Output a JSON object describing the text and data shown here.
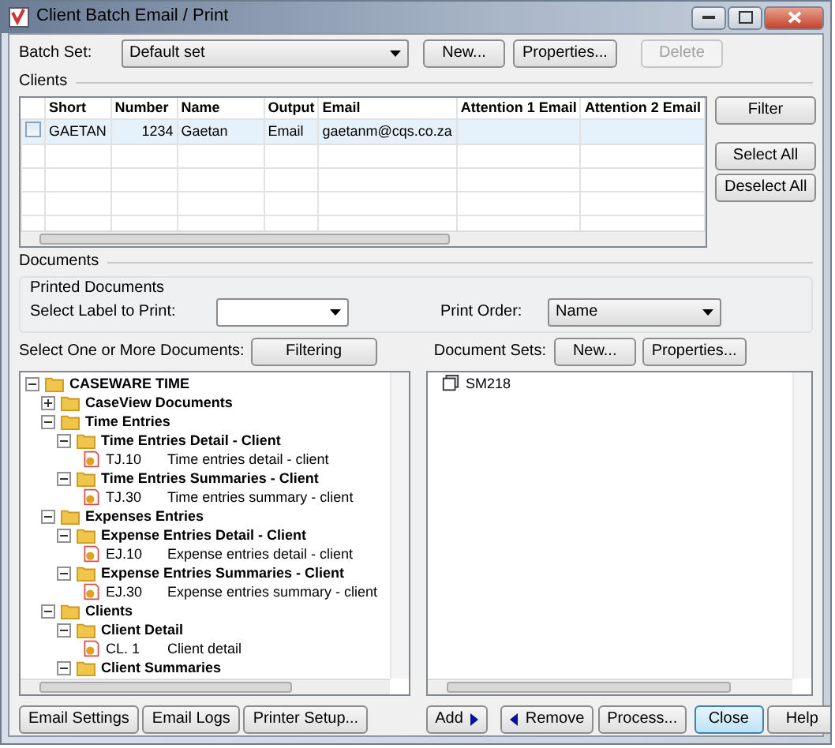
{
  "window": {
    "title": "Client Batch Email / Print"
  },
  "batch_set": {
    "label": "Batch Set:",
    "value": "Default set",
    "buttons": [
      {
        "label": "New...",
        "disabled": false
      },
      {
        "label": "Properties...",
        "disabled": false
      },
      {
        "label": "Delete",
        "disabled": true
      }
    ]
  },
  "clients": {
    "title": "Clients",
    "columns": [
      "Short",
      "Number",
      "Name",
      "Output",
      "Email",
      "Attention 1 Email",
      "Attention 2 Email"
    ],
    "rows": [
      {
        "checked": false,
        "selected": true,
        "cells": [
          "GAETAN",
          "1234",
          "Gaetan",
          "Email",
          "gaetanm@cqs.co.za",
          "",
          ""
        ]
      }
    ],
    "side_buttons": [
      "Filter",
      "Select All",
      "Deselect All"
    ]
  },
  "documents": {
    "title": "Documents",
    "printed_title": "Printed Documents",
    "label_to_print": {
      "label": "Select Label to Print:"
    },
    "print_order": {
      "label": "Print Order:",
      "value": "Name"
    },
    "select_label": "Select One or More Documents:",
    "filtering_button": "Filtering",
    "sets_label": "Document Sets:",
    "sets_buttons": [
      "New...",
      "Properties..."
    ],
    "tree": [
      {
        "kind": "folder",
        "label": "CASEWARE TIME",
        "expanded": true,
        "children": [
          {
            "kind": "folder",
            "label": "CaseView Documents",
            "expanded": false
          },
          {
            "kind": "folder",
            "label": "Time Entries",
            "expanded": true,
            "children": [
              {
                "kind": "folder",
                "label": "Time Entries Detail - Client",
                "expanded": true,
                "children": [
                  {
                    "kind": "document",
                    "code": "TJ.10",
                    "description": "Time entries detail - client"
                  }
                ]
              },
              {
                "kind": "folder",
                "label": "Time Entries Summaries - Client",
                "expanded": true,
                "children": [
                  {
                    "kind": "document",
                    "code": "TJ.30",
                    "description": "Time entries summary - client"
                  }
                ]
              }
            ]
          },
          {
            "kind": "folder",
            "label": "Expenses Entries",
            "expanded": true,
            "children": [
              {
                "kind": "folder",
                "label": "Expense Entries Detail - Client",
                "expanded": true,
                "children": [
                  {
                    "kind": "document",
                    "code": "EJ.10",
                    "description": "Expense entries detail - client"
                  }
                ]
              },
              {
                "kind": "folder",
                "label": "Expense Entries Summaries - Client",
                "expanded": true,
                "children": [
                  {
                    "kind": "document",
                    "code": "EJ.30",
                    "description": "Expense entries summary - client"
                  }
                ]
              }
            ]
          },
          {
            "kind": "folder",
            "label": "Clients",
            "expanded": true,
            "children": [
              {
                "kind": "folder",
                "label": "Client Detail",
                "expanded": true,
                "children": [
                  {
                    "kind": "document",
                    "code": "CL. 1",
                    "description": "Client detail"
                  }
                ]
              },
              {
                "kind": "folder",
                "label": "Client Summaries",
                "expanded": true
              }
            ]
          }
        ]
      }
    ],
    "document_sets": [
      {
        "label": "SM218"
      }
    ]
  },
  "footer": {
    "left_buttons": [
      "Email Settings",
      "Email Logs",
      "Printer Setup..."
    ],
    "add": "Add",
    "remove": "Remove",
    "right_buttons": [
      {
        "label": "Process...",
        "default": false
      },
      {
        "label": "Close",
        "default": true
      },
      {
        "label": "Help",
        "default": false
      }
    ]
  }
}
